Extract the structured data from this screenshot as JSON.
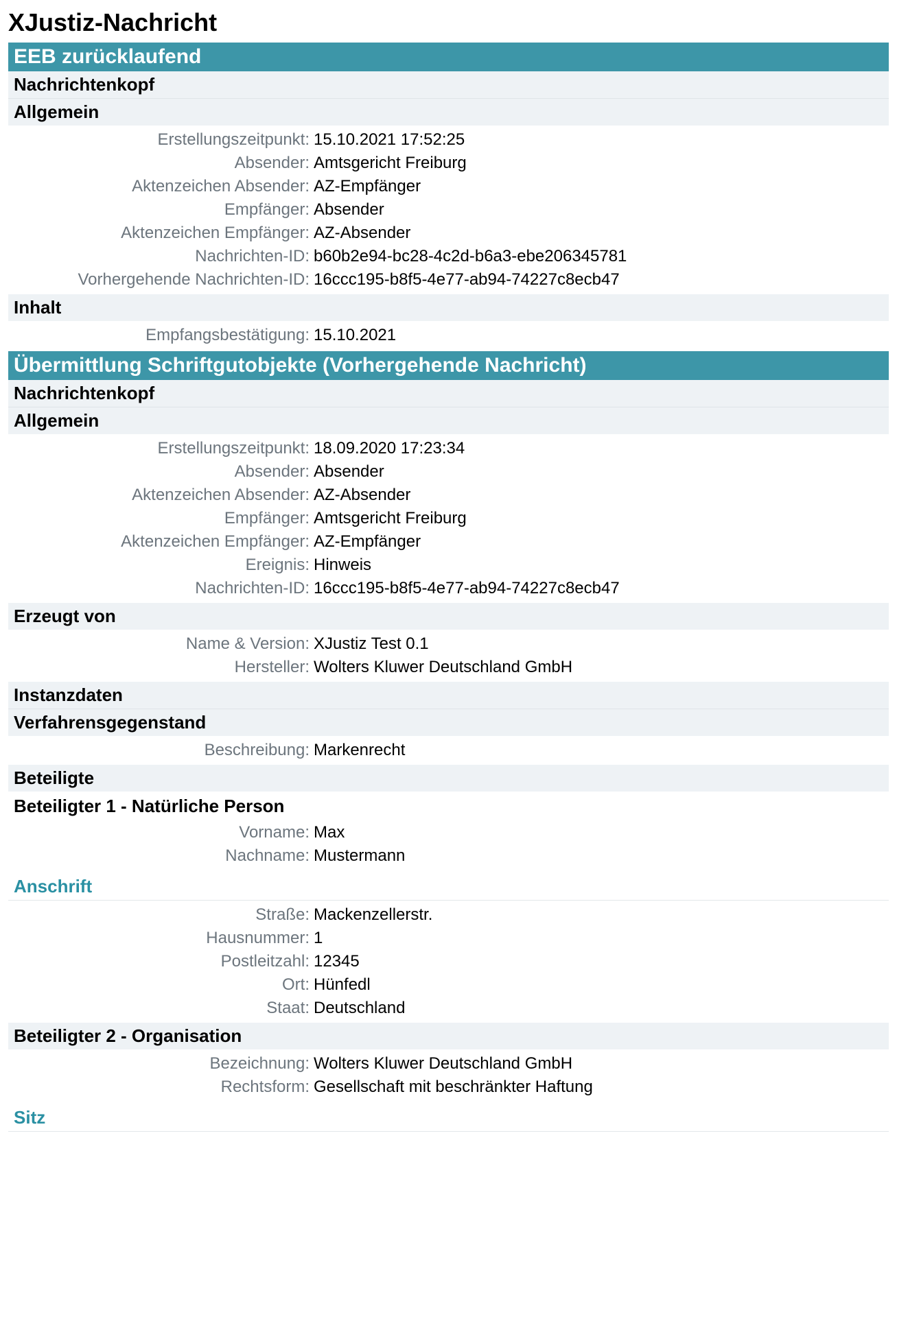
{
  "page_title": "XJustiz-Nachricht",
  "sections": [
    {
      "type": "primary",
      "text": "EEB zurücklaufend"
    },
    {
      "type": "sub",
      "text": "Nachrichtenkopf"
    },
    {
      "type": "sub2",
      "text": "Allgemein"
    },
    {
      "type": "kv",
      "rows": [
        {
          "k": "Erstellungszeitpunkt:",
          "v": "15.10.2021 17:52:25"
        },
        {
          "k": "Absender:",
          "v": "Amtsgericht Freiburg"
        },
        {
          "k": "Aktenzeichen Absender:",
          "v": "AZ-Empfänger"
        },
        {
          "k": "Empfänger:",
          "v": "Absender"
        },
        {
          "k": "Aktenzeichen Empfänger:",
          "v": "AZ-Absender"
        },
        {
          "k": "Nachrichten-ID:",
          "v": "b60b2e94-bc28-4c2d-b6a3-ebe206345781"
        },
        {
          "k": "Vorhergehende Nachrichten-ID:",
          "v": "16ccc195-b8f5-4e77-ab94-74227c8ecb47"
        }
      ]
    },
    {
      "type": "sub",
      "text": "Inhalt"
    },
    {
      "type": "kv",
      "rows": [
        {
          "k": "Empfangsbestätigung:",
          "v": "15.10.2021"
        }
      ]
    },
    {
      "type": "primary",
      "text": "Übermittlung Schriftgutobjekte (Vorhergehende Nachricht)"
    },
    {
      "type": "sub",
      "text": "Nachrichtenkopf"
    },
    {
      "type": "sub2",
      "text": "Allgemein"
    },
    {
      "type": "kv",
      "rows": [
        {
          "k": "Erstellungszeitpunkt:",
          "v": "18.09.2020 17:23:34"
        },
        {
          "k": "Absender:",
          "v": "Absender"
        },
        {
          "k": "Aktenzeichen Absender:",
          "v": "AZ-Absender"
        },
        {
          "k": "Empfänger:",
          "v": "Amtsgericht Freiburg"
        },
        {
          "k": "Aktenzeichen Empfänger:",
          "v": "AZ-Empfänger"
        },
        {
          "k": "Ereignis:",
          "v": "Hinweis"
        },
        {
          "k": "Nachrichten-ID:",
          "v": "16ccc195-b8f5-4e77-ab94-74227c8ecb47"
        }
      ]
    },
    {
      "type": "sub",
      "text": "Erzeugt von"
    },
    {
      "type": "kv",
      "rows": [
        {
          "k": "Name & Version:",
          "v": "XJustiz Test 0.1"
        },
        {
          "k": "Hersteller:",
          "v": "Wolters Kluwer Deutschland GmbH"
        }
      ]
    },
    {
      "type": "sub",
      "text": "Instanzdaten"
    },
    {
      "type": "sub2",
      "text": "Verfahrensgegenstand"
    },
    {
      "type": "kv",
      "rows": [
        {
          "k": "Beschreibung:",
          "v": "Markenrecht"
        }
      ]
    },
    {
      "type": "sub",
      "text": "Beteiligte"
    },
    {
      "type": "plain",
      "text": "Beteiligter 1 - Natürliche Person"
    },
    {
      "type": "kv",
      "rows": [
        {
          "k": "Vorname:",
          "v": "Max"
        },
        {
          "k": "Nachname:",
          "v": "Mustermann"
        }
      ]
    },
    {
      "type": "teal",
      "text": "Anschrift"
    },
    {
      "type": "kv",
      "rows": [
        {
          "k": "Straße:",
          "v": "Mackenzellerstr."
        },
        {
          "k": "Hausnummer:",
          "v": "1"
        },
        {
          "k": "Postleitzahl:",
          "v": "12345"
        },
        {
          "k": "Ort:",
          "v": "Hünfedl"
        },
        {
          "k": "Staat:",
          "v": "Deutschland"
        }
      ]
    },
    {
      "type": "sub",
      "text": "Beteiligter 2 - Organisation"
    },
    {
      "type": "kv",
      "rows": [
        {
          "k": "Bezeichnung:",
          "v": "Wolters Kluwer Deutschland GmbH"
        },
        {
          "k": "Rechtsform:",
          "v": "Gesellschaft mit beschränkter Haftung"
        }
      ]
    },
    {
      "type": "teal",
      "text": "Sitz"
    }
  ]
}
